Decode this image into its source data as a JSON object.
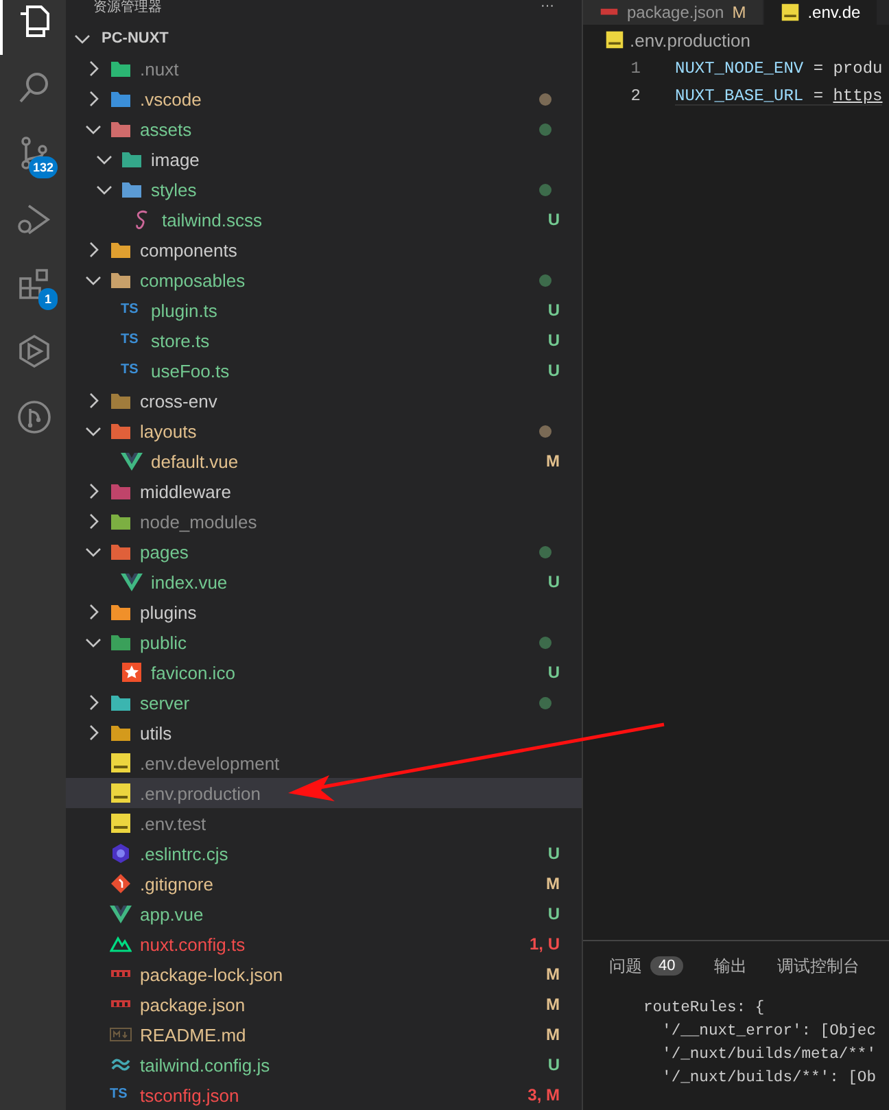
{
  "activity_bar": {
    "items": [
      {
        "kind": "explorer",
        "selected": true
      },
      {
        "kind": "search",
        "selected": false
      },
      {
        "kind": "source-control",
        "selected": false,
        "badge": "132"
      },
      {
        "kind": "debug",
        "selected": false
      },
      {
        "kind": "extensions",
        "selected": false,
        "badge": "1"
      },
      {
        "kind": "remote",
        "selected": false
      },
      {
        "kind": "git-graph",
        "selected": false
      }
    ]
  },
  "explorer": {
    "title": "资源管理器",
    "more": "···",
    "root": {
      "label": "PC-NUXT",
      "expanded": true
    },
    "items": [
      {
        "name": {
          "text": ".nuxt",
          "color": "#8c8c8c"
        },
        "kind": "folder",
        "color": "#2bb673",
        "expanded": false,
        "selected": false
      },
      {
        "name": {
          "text": ".vscode",
          "color": "#e2c08d"
        },
        "kind": "folder",
        "color": "#3b8fd9",
        "expanded": false,
        "dot": {
          "color": "#7a6a55"
        },
        "selected": false
      },
      {
        "name": {
          "text": "assets",
          "color": "#73c991"
        },
        "kind": "folder",
        "color": "#d06b6b",
        "expanded": true,
        "dot": {
          "color": "#3d6b4b"
        },
        "selected": false,
        "children": [
          {
            "name": {
              "text": "image",
              "color": "#cccccc"
            },
            "kind": "folder",
            "color": "#34a88a",
            "expanded": true,
            "selected": false
          },
          {
            "name": {
              "text": "styles",
              "color": "#73c991"
            },
            "kind": "folder",
            "color": "#5b9bd5",
            "expanded": true,
            "dot": {
              "color": "#3d6b4b"
            },
            "selected": false,
            "children": [
              {
                "name": {
                  "text": "tailwind.scss",
                  "color": "#73c991"
                },
                "kind": "scss",
                "badge": "U",
                "selected": false
              }
            ]
          }
        ]
      },
      {
        "name": {
          "text": "components",
          "color": "#cccccc"
        },
        "kind": "folder",
        "color": "#e0a030",
        "expanded": false,
        "selected": false
      },
      {
        "name": {
          "text": "composables",
          "color": "#73c991"
        },
        "kind": "folder",
        "color": "#c8a06a",
        "expanded": true,
        "dot": {
          "color": "#3d6b4b"
        },
        "selected": false,
        "children": [
          {
            "name": {
              "text": "plugin.ts",
              "color": "#73c991"
            },
            "kind": "ts",
            "icon_label": "TS",
            "badge": "U",
            "selected": false
          },
          {
            "name": {
              "text": "store.ts",
              "color": "#73c991"
            },
            "kind": "ts",
            "icon_label": "TS",
            "badge": "U",
            "selected": false
          },
          {
            "name": {
              "text": "useFoo.ts",
              "color": "#73c991"
            },
            "kind": "ts",
            "icon_label": "TS",
            "badge": "U",
            "selected": false
          }
        ]
      },
      {
        "name": {
          "text": "cross-env",
          "color": "#cccccc"
        },
        "kind": "folder",
        "color": "#a07c3c",
        "expanded": false,
        "selected": false
      },
      {
        "name": {
          "text": "layouts",
          "color": "#e2c08d"
        },
        "kind": "folder",
        "color": "#e0603a",
        "expanded": true,
        "dot": {
          "color": "#7a6a55"
        },
        "selected": false,
        "children": [
          {
            "name": {
              "text": "default.vue",
              "color": "#e2c08d"
            },
            "kind": "vue",
            "badge": "M",
            "selected": false
          }
        ]
      },
      {
        "name": {
          "text": "middleware",
          "color": "#cccccc"
        },
        "kind": "folder",
        "color": "#c0446a",
        "expanded": false,
        "selected": false
      },
      {
        "name": {
          "text": "node_modules",
          "color": "#8c8c8c"
        },
        "kind": "folder",
        "color": "#7caf42",
        "expanded": false,
        "selected": false
      },
      {
        "name": {
          "text": "pages",
          "color": "#73c991"
        },
        "kind": "folder",
        "color": "#e0603a",
        "expanded": true,
        "dot": {
          "color": "#3d6b4b"
        },
        "selected": false,
        "children": [
          {
            "name": {
              "text": "index.vue",
              "color": "#73c991"
            },
            "kind": "vue",
            "badge": "U",
            "selected": false
          }
        ]
      },
      {
        "name": {
          "text": "plugins",
          "color": "#cccccc"
        },
        "kind": "folder",
        "color": "#f0902a",
        "expanded": false,
        "selected": false
      },
      {
        "name": {
          "text": "public",
          "color": "#73c991"
        },
        "kind": "folder",
        "color": "#3aa05a",
        "expanded": true,
        "dot": {
          "color": "#3d6b4b"
        },
        "selected": false,
        "children": [
          {
            "name": {
              "text": "favicon.ico",
              "color": "#73c991"
            },
            "kind": "ico",
            "badge": "U",
            "selected": false
          }
        ]
      },
      {
        "name": {
          "text": "server",
          "color": "#73c991"
        },
        "kind": "folder",
        "color": "#3bb5b0",
        "expanded": false,
        "dot": {
          "color": "#3d6b4b"
        },
        "selected": false
      },
      {
        "name": {
          "text": "utils",
          "color": "#cccccc"
        },
        "kind": "folder",
        "color": "#d49a1c",
        "expanded": false,
        "selected": false
      },
      {
        "name": {
          "text": ".env.development",
          "color": "#8c8c8c"
        },
        "kind": "env",
        "selected": false
      },
      {
        "name": {
          "text": ".env.production",
          "color": "#8c8c8c"
        },
        "kind": "env",
        "selected": true
      },
      {
        "name": {
          "text": ".env.test",
          "color": "#8c8c8c"
        },
        "kind": "env",
        "selected": false
      },
      {
        "name": {
          "text": ".eslintrc.cjs",
          "color": "#73c991"
        },
        "kind": "eslint",
        "badge": "U",
        "selected": false
      },
      {
        "name": {
          "text": ".gitignore",
          "color": "#e2c08d"
        },
        "kind": "git",
        "badge": "M",
        "selected": false
      },
      {
        "name": {
          "text": "app.vue",
          "color": "#73c991"
        },
        "kind": "vue",
        "badge": "U",
        "selected": false
      },
      {
        "name": {
          "text": "nuxt.config.ts",
          "color": "#f14c4c"
        },
        "kind": "nuxt",
        "badge": "1, U",
        "selected": false
      },
      {
        "name": {
          "text": "package-lock.json",
          "color": "#e2c08d"
        },
        "kind": "npm",
        "badge": "M",
        "selected": false
      },
      {
        "name": {
          "text": "package.json",
          "color": "#e2c08d"
        },
        "kind": "npm",
        "badge": "M",
        "selected": false
      },
      {
        "name": {
          "text": "README.md",
          "color": "#e2c08d"
        },
        "kind": "md",
        "badge": "M",
        "selected": false
      },
      {
        "name": {
          "text": "tailwind.config.js",
          "color": "#73c991"
        },
        "kind": "tailwind",
        "badge": "U",
        "selected": false
      },
      {
        "name": {
          "text": "tsconfig.json",
          "color": "#f14c4c"
        },
        "kind": "tsconfig",
        "icon_label": "TS",
        "badge": "3, M",
        "selected": false
      }
    ]
  },
  "editor": {
    "tabs": [
      {
        "label": "package.json",
        "badge": "M",
        "kind": "npm",
        "selected": false
      },
      {
        "label": ".env.de",
        "kind": "env",
        "selected": true
      }
    ],
    "breadcrumb": ".env.production",
    "lines": [
      {
        "number": "1",
        "key": "NUXT_NODE_ENV",
        "sep": "=",
        "value": "produ",
        "current": false
      },
      {
        "number": "2",
        "key": "NUXT_BASE_URL",
        "sep": "=",
        "value": "https",
        "current": true
      }
    ]
  },
  "panel": {
    "tabs": [
      {
        "label": "问题",
        "count": "40",
        "selected": false
      },
      {
        "label": "输出",
        "selected": false
      },
      {
        "label": "调试控制台",
        "selected": false
      }
    ],
    "output": [
      "routeRules: {",
      "  '/__nuxt_error': [Objec",
      "  '/_nuxt/builds/meta/**'",
      "  '/_nuxt/builds/**': [Ob"
    ]
  }
}
